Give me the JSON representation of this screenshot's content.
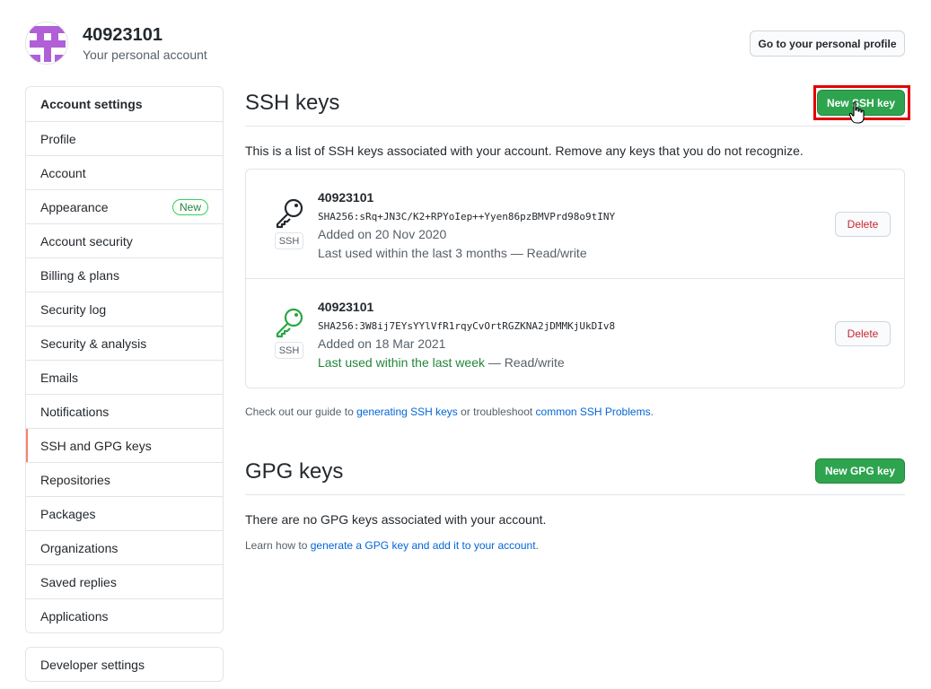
{
  "account": {
    "name": "40923101",
    "subtitle": "Your personal account",
    "profile_button": "Go to your personal profile"
  },
  "sidebar": {
    "header": "Account settings",
    "items": [
      {
        "label": "Profile"
      },
      {
        "label": "Account"
      },
      {
        "label": "Appearance",
        "badge": "New"
      },
      {
        "label": "Account security"
      },
      {
        "label": "Billing & plans"
      },
      {
        "label": "Security log"
      },
      {
        "label": "Security & analysis"
      },
      {
        "label": "Emails"
      },
      {
        "label": "Notifications"
      },
      {
        "label": "SSH and GPG keys",
        "selected": true
      },
      {
        "label": "Repositories"
      },
      {
        "label": "Packages"
      },
      {
        "label": "Organizations"
      },
      {
        "label": "Saved replies"
      },
      {
        "label": "Applications"
      }
    ],
    "developer_settings": "Developer settings"
  },
  "ssh": {
    "title": "SSH keys",
    "new_button": "New SSH key",
    "description": "This is a list of SSH keys associated with your account. Remove any keys that you do not recognize.",
    "keys": [
      {
        "title": "40923101",
        "fingerprint": "SHA256:sRq+JN3C/K2+RPYoIep++Yyen86pzBMVPrd98o9tINY",
        "added": "Added on 20 Nov 2020",
        "used_prefix": "Last used within the last 3 months",
        "used_suffix": " — Read/write",
        "type_label": "SSH",
        "delete": "Delete",
        "icon_color": "#24292e"
      },
      {
        "title": "40923101",
        "fingerprint": "SHA256:3W8ij7EYsYYlVfR1rqyCvOrtRGZKNA2jDMMKjUkDIv8",
        "added": "Added on 18 Mar 2021",
        "used_prefix": "Last used within the last week",
        "used_suffix": " — Read/write",
        "type_label": "SSH",
        "delete": "Delete",
        "icon_color": "#28a745"
      }
    ],
    "guide_prefix": "Check out our guide to ",
    "guide_link1": "generating SSH keys",
    "guide_middle": " or troubleshoot ",
    "guide_link2": "common SSH Problems",
    "guide_suffix": "."
  },
  "gpg": {
    "title": "GPG keys",
    "new_button": "New GPG key",
    "empty": "There are no GPG keys associated with your account.",
    "learn_prefix": "Learn how to ",
    "learn_link": "generate a GPG key and add it to your account",
    "learn_suffix": "."
  },
  "colors": {
    "primary_green": "#2ea44f",
    "link_blue": "#0366d6",
    "danger_red": "#cb2431",
    "selected_accent": "#f9826c",
    "highlight_red": "#e00000",
    "avatar_purple": "#b05fd6"
  }
}
